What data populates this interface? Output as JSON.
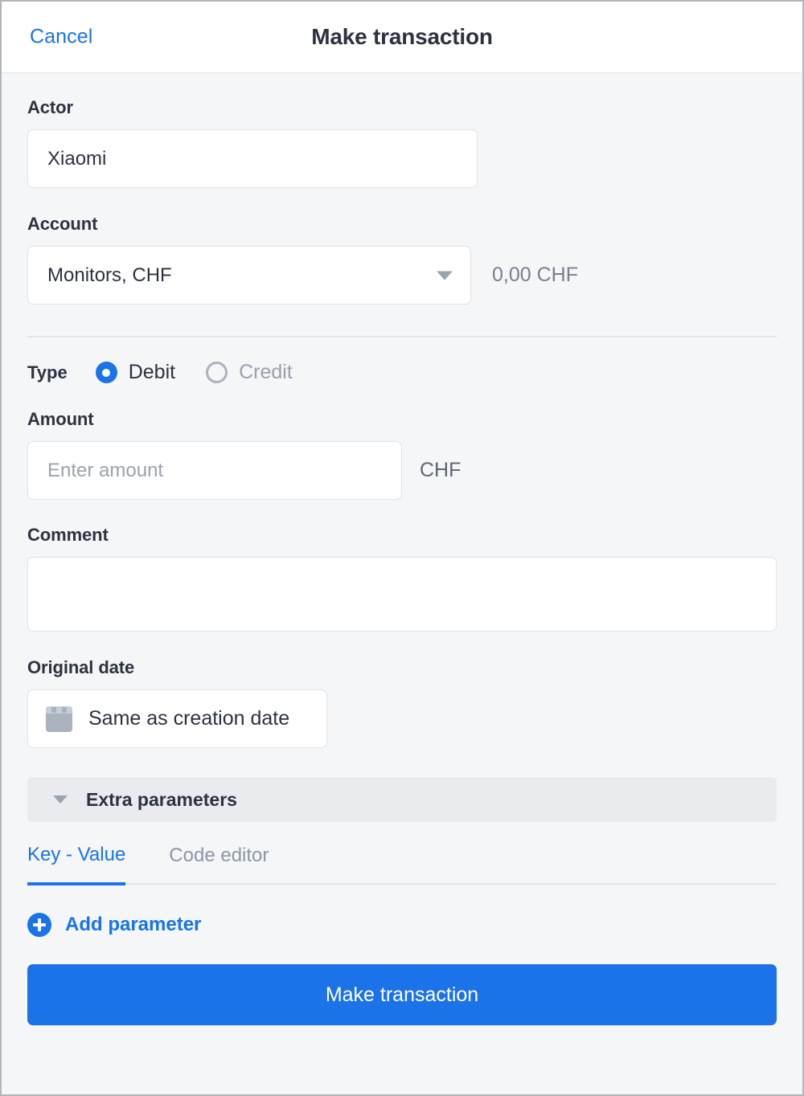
{
  "header": {
    "cancel_label": "Cancel",
    "title": "Make transaction"
  },
  "form": {
    "actor": {
      "label": "Actor",
      "value": "Xiaomi"
    },
    "account": {
      "label": "Account",
      "selected": "Monitors, CHF",
      "balance": "0,00 CHF"
    },
    "type": {
      "label": "Type",
      "options": [
        {
          "label": "Debit",
          "selected": true
        },
        {
          "label": "Credit",
          "selected": false
        }
      ]
    },
    "amount": {
      "label": "Amount",
      "value": "",
      "placeholder": "Enter amount",
      "currency": "CHF"
    },
    "comment": {
      "label": "Comment",
      "value": "",
      "placeholder": ""
    },
    "original_date": {
      "label": "Original date",
      "value": "Same as creation date",
      "icon": "calendar-icon"
    },
    "extra_parameters": {
      "title": "Extra parameters",
      "expanded": true,
      "caret_icon": "chevron-down-icon",
      "tabs": [
        {
          "label": "Key - Value",
          "active": true
        },
        {
          "label": "Code editor",
          "active": false
        }
      ],
      "add_parameter_label": "Add parameter",
      "add_parameter_icon": "plus-circle-icon"
    }
  },
  "footer": {
    "submit_label": "Make transaction"
  },
  "colors": {
    "accent": "#1a73e8",
    "submit": "#1c72e8",
    "text": "#2c3240",
    "muted": "#9aa3b0",
    "background": "#f4f6f8",
    "panel": "#ffffff",
    "border": "#dfe3e8"
  }
}
